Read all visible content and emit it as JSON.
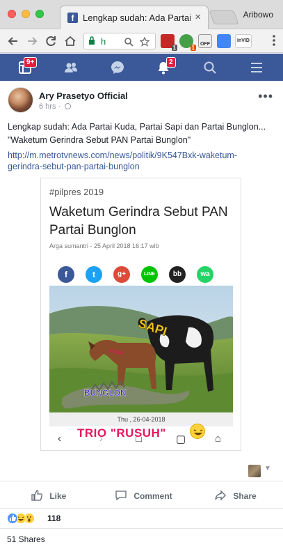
{
  "browser": {
    "tab_title": "Lengkap sudah: Ada Partai Ku",
    "tab_close": "×",
    "profile_name": "Aribowo",
    "url_text": "h",
    "ext_badges": [
      "1",
      "1"
    ],
    "ext_labels": [
      "OFF",
      "InVID"
    ]
  },
  "fb_nav": {
    "home_badge": "9+",
    "notif_badge": "2"
  },
  "post": {
    "author": "Ary Prasetyo Official",
    "time": "6 hrs",
    "separator": "·",
    "more": "•••",
    "text_line1": "Lengkap sudah: Ada Partai Kuda, Partai Sapi dan Partai Bunglon...",
    "text_line2": "\"Waketum Gerindra Sebut PAN Partai Bunglon\"",
    "link": "http://m.metrotvnews.com/news/politik/9K547Bxk-waketum-gerindra-sebut-pan-partai-bunglon"
  },
  "card": {
    "hashtag": "#pilpres 2019",
    "title": "Waketum Gerindra Sebut PAN Partai Bunglon",
    "byline": "Arga sumantri - 25 April 2018 16:17 wib",
    "share_icons": [
      "f",
      "t",
      "g+",
      "LINE",
      "bb",
      "wa"
    ],
    "photo_labels": {
      "sapi": "SAPI",
      "kuda": "KUDA",
      "bunglon": "BUNGLON"
    },
    "date_bar": "Thu , 26-04-2018",
    "caption": "TRIO \"RUSUH\""
  },
  "actions": {
    "like": "Like",
    "comment": "Comment",
    "share": "Share"
  },
  "footer": {
    "reaction_count": "118",
    "shares": "51 Shares"
  },
  "colors": {
    "fb_blue": "#3b5998",
    "link": "#365899",
    "badge_red": "#e41e3f",
    "caption_pink": "#e5175b"
  }
}
